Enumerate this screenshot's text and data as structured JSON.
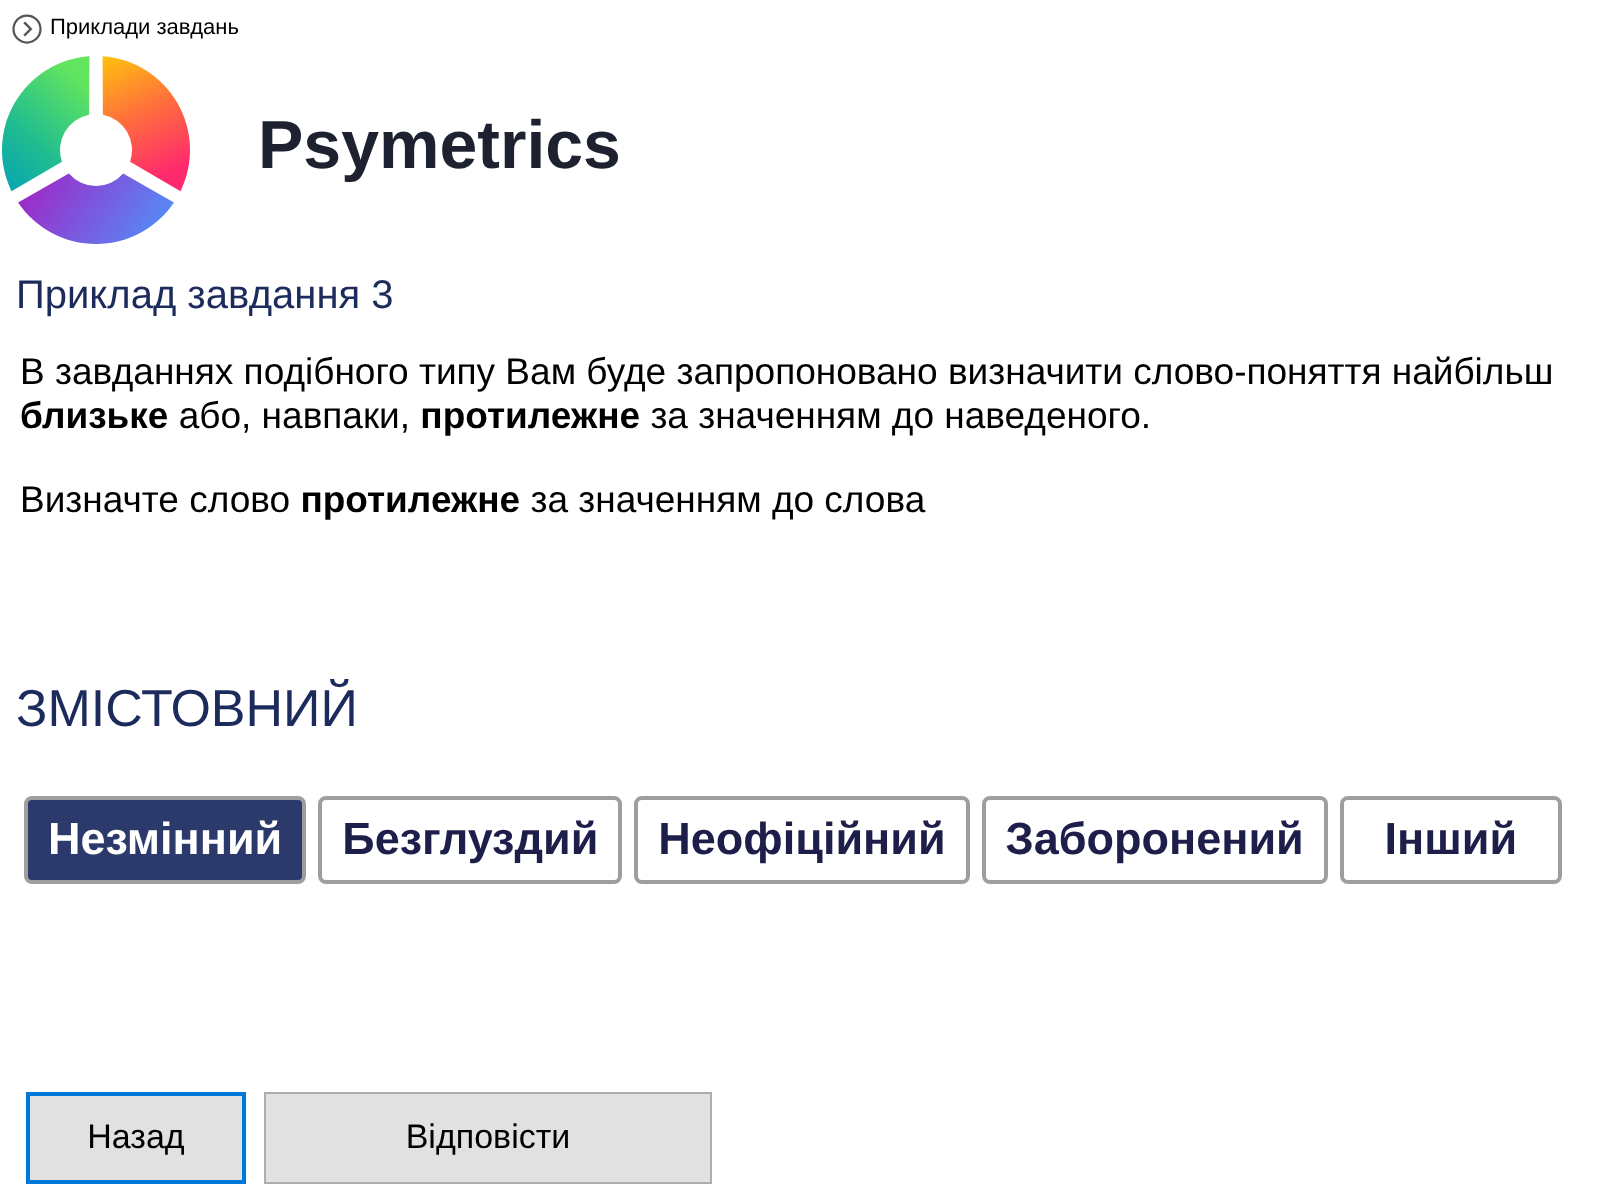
{
  "link": {
    "label": "Приклади завдань"
  },
  "logo": {
    "name": "Psymetrics"
  },
  "task": {
    "title": "Приклад завдання 3",
    "description": "В завданнях подібного типу Вам буде запропоновано визначити слово-поняття найбільш **близьке** або, навпаки, **протилежне** за значенням до наведеного.",
    "instruction": "Визначте слово **протилежне** за значенням до слова",
    "word": "ЗМІСТОВНИЙ"
  },
  "options": [
    {
      "label": "Незмінний",
      "selected": true
    },
    {
      "label": "Безглуздий",
      "selected": false
    },
    {
      "label": "Неофіційний",
      "selected": false
    },
    {
      "label": "Заборонений",
      "selected": false
    },
    {
      "label": "Інший",
      "selected": false
    }
  ],
  "buttons": [
    {
      "label": "Назад",
      "focused": true
    },
    {
      "label": "Відповісти",
      "focused": false
    }
  ]
}
